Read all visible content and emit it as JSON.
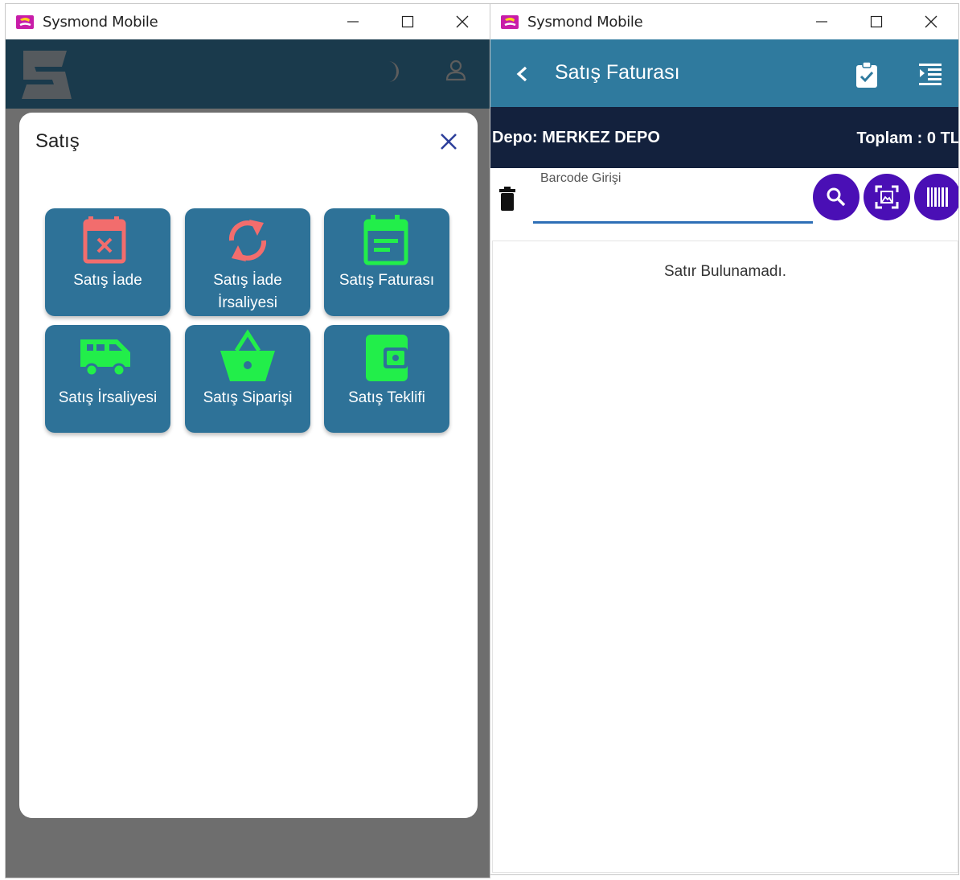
{
  "left_window": {
    "title": "Sysmond Mobile",
    "modal": {
      "title": "Satış",
      "tiles": [
        {
          "label": "Satış İade",
          "icon": "calendar-x-icon",
          "icon_color": "#f26d6d"
        },
        {
          "label": "Satış İade İrsaliyesi",
          "icon": "sync-icon",
          "icon_color": "#f26d6d"
        },
        {
          "label": "Satış Faturası",
          "icon": "calendar-note-icon",
          "icon_color": "#22ee4a"
        },
        {
          "label": "Satış İrsaliyesi",
          "icon": "van-icon",
          "icon_color": "#22ee4a"
        },
        {
          "label": "Satış Siparişi",
          "icon": "basket-icon",
          "icon_color": "#22ee4a"
        },
        {
          "label": "Satış Teklifi",
          "icon": "wallet-icon",
          "icon_color": "#22ee4a"
        }
      ]
    }
  },
  "right_window": {
    "title": "Sysmond Mobile",
    "header": {
      "title": "Satış Faturası"
    },
    "info": {
      "depo": "Depo: MERKEZ DEPO",
      "toplam": "Toplam : 0 TL"
    },
    "barcode": {
      "label": "Barcode Girişi",
      "value": ""
    },
    "empty_message": "Satır Bulunamadı."
  },
  "colors": {
    "header_dark": "#1a3a4c",
    "header_teal": "#2f7a9e",
    "info_bar": "#13213d",
    "tile_bg": "#2e7298",
    "action_purple": "#4a0fb5",
    "overlay_gray": "#6e6e6e"
  }
}
